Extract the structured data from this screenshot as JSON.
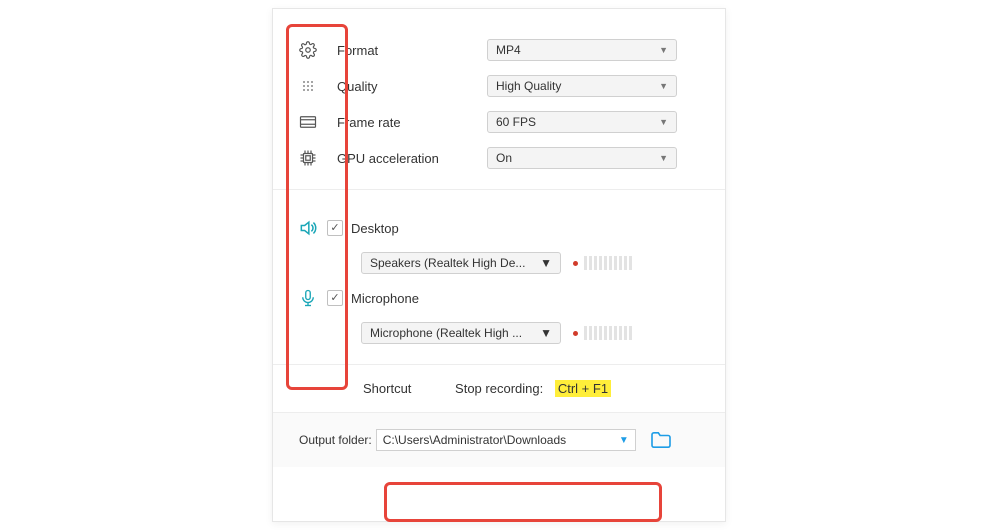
{
  "video": {
    "format_label": "Format",
    "format_value": "MP4",
    "quality_label": "Quality",
    "quality_value": "High Quality",
    "framerate_label": "Frame rate",
    "framerate_value": "60 FPS",
    "gpu_label": "GPU acceleration",
    "gpu_value": "On"
  },
  "audio": {
    "desktop": {
      "label": "Desktop",
      "checked": true,
      "device": "Speakers (Realtek High De..."
    },
    "microphone": {
      "label": "Microphone",
      "checked": true,
      "device": "Microphone (Realtek High ..."
    }
  },
  "shortcut": {
    "section_label": "Shortcut",
    "stop_label": "Stop recording:",
    "stop_value": "Ctrl + F1"
  },
  "output": {
    "label": "Output folder:",
    "path": "C:\\Users\\Administrator\\Downloads"
  }
}
